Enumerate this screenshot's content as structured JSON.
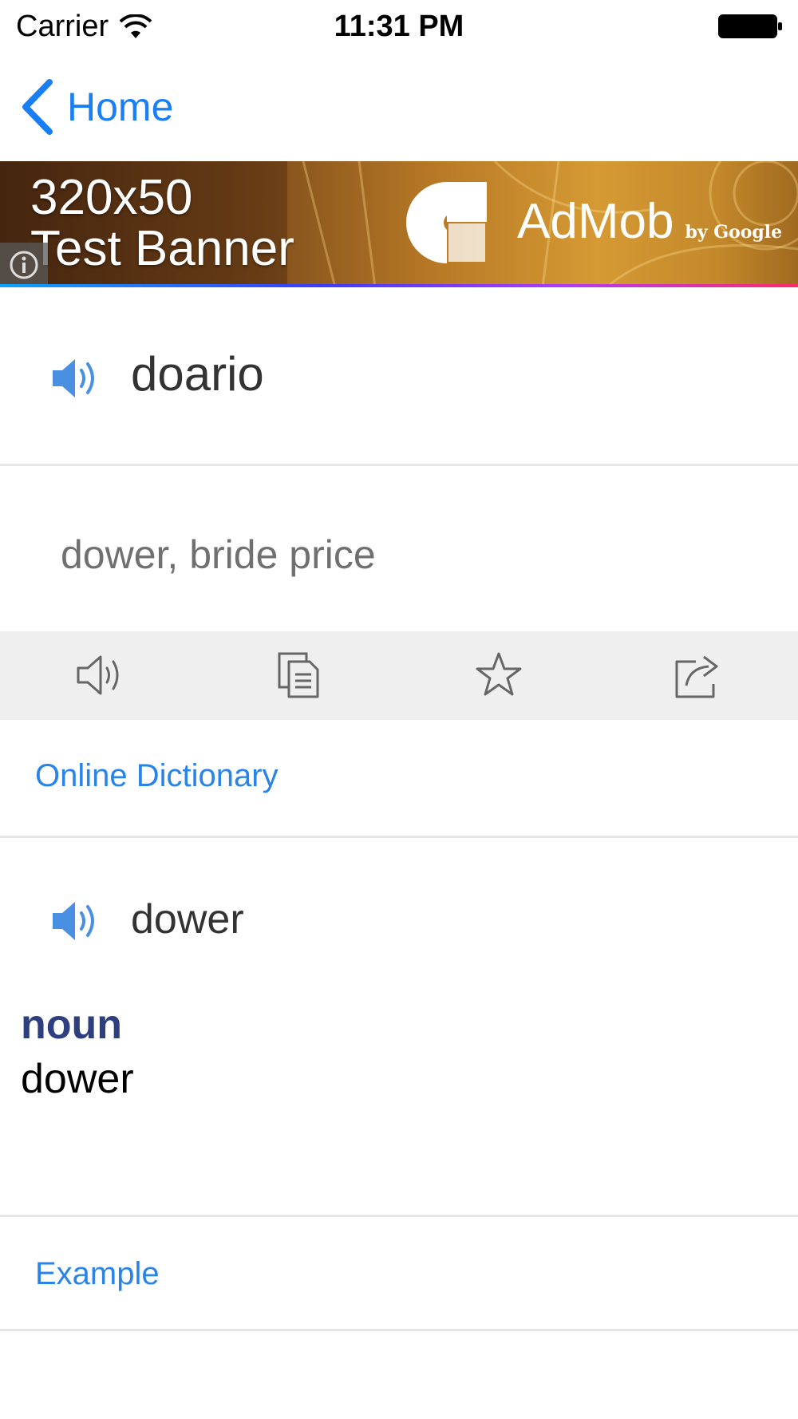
{
  "status_bar": {
    "carrier": "Carrier",
    "time": "11:31 PM"
  },
  "nav": {
    "back_label": "Home"
  },
  "ad": {
    "line1": "320x50",
    "line2": "Test Banner",
    "brand": "AdMob",
    "by": "by Google"
  },
  "entry": {
    "word": "doario",
    "translation": "dower, bride price"
  },
  "toolbar": {
    "icons": [
      "speaker-outline-icon",
      "copy-icon",
      "star-icon",
      "share-icon"
    ]
  },
  "online_dictionary": {
    "label": "Online Dictionary",
    "word": "dower",
    "part_of_speech": "noun",
    "definition": "dower"
  },
  "example": {
    "label": "Example"
  },
  "colors": {
    "accent": "#1a7ff5",
    "link": "#2a84e8",
    "pos": "#2e3f7f",
    "toolbar_bg": "#efefef"
  }
}
